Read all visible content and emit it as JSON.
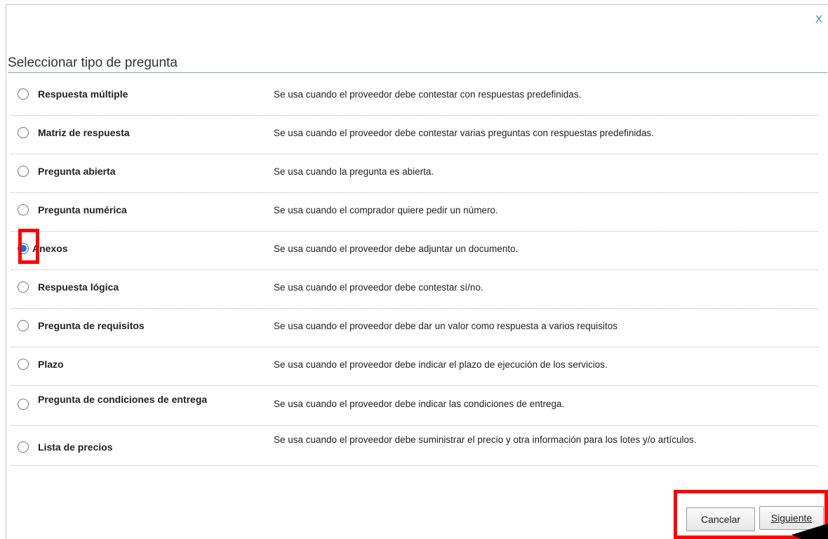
{
  "dialog": {
    "close_label": "X",
    "title": "Seleccionar tipo de pregunta"
  },
  "question_types": [
    {
      "label": "Respuesta múltiple",
      "description": "Se usa cuando el proveedor debe contestar con respuestas predefinidas.",
      "selected": false
    },
    {
      "label": "Matriz de respuesta",
      "description": "Se usa cuando el proveedor debe contestar varias preguntas con respuestas predefinidas.",
      "selected": false
    },
    {
      "label": "Pregunta abierta",
      "description": "Se usa cuando la pregunta es abierta.",
      "selected": false
    },
    {
      "label": "Pregunta numérica",
      "description": "Se usa cuando el comprador quiere pedir un número.",
      "selected": false
    },
    {
      "label": "Anexos",
      "description": "Se usa cuando el proveedor debe adjuntar un documento.",
      "selected": true
    },
    {
      "label": "Respuesta lógica",
      "description": "Se usa cuando el proveedor debe contestar sí/no.",
      "selected": false
    },
    {
      "label": "Pregunta de requisitos",
      "description": "Se usa cuando el proveedor debe dar un valor como respuesta a varios requisitos",
      "selected": false
    },
    {
      "label": "Plazo",
      "description": "Se usa cuando el proveedor debe indicar el plazo de ejecución de los servicios.",
      "selected": false
    },
    {
      "label": "Pregunta de condiciones de entrega",
      "description": "Se usa cuando el proveedor debe indicar las condiciones de entrega.",
      "selected": false
    },
    {
      "label": "Lista de precios",
      "description": "Se usa cuando el proveedor debe suministrar el precio y otra información para los lotes y/o artículos.",
      "selected": false
    }
  ],
  "footer": {
    "cancel_label": "Cancelar",
    "next_label": "Siguiente"
  },
  "colors": {
    "highlight": "#ff0000",
    "radio_selected": "#1e6fd9",
    "title_rule": "#7aa3c9"
  }
}
